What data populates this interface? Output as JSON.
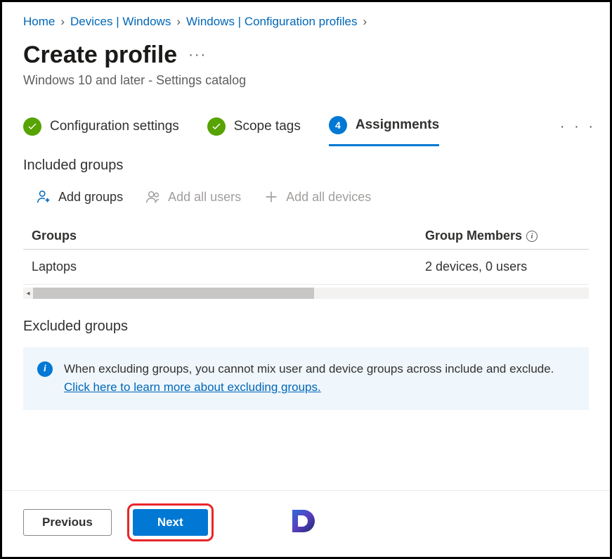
{
  "breadcrumb": {
    "home": "Home",
    "devices": "Devices | Windows",
    "profiles": "Windows | Configuration profiles"
  },
  "header": {
    "title": "Create profile",
    "subtitle": "Windows 10 and later - Settings catalog"
  },
  "steps": {
    "config": "Configuration settings",
    "scope": "Scope tags",
    "assign_num": "4",
    "assign": "Assignments"
  },
  "included": {
    "heading": "Included groups",
    "add_groups": "Add groups",
    "add_users": "Add all users",
    "add_devices": "Add all devices",
    "col_groups": "Groups",
    "col_members": "Group Members",
    "rows": [
      {
        "name": "Laptops",
        "members": "2 devices, 0 users"
      }
    ]
  },
  "excluded": {
    "heading": "Excluded groups",
    "banner_text": "When excluding groups, you cannot mix user and device groups across include and exclude. ",
    "banner_link": "Click here to learn more about excluding groups."
  },
  "footer": {
    "previous": "Previous",
    "next": "Next"
  }
}
